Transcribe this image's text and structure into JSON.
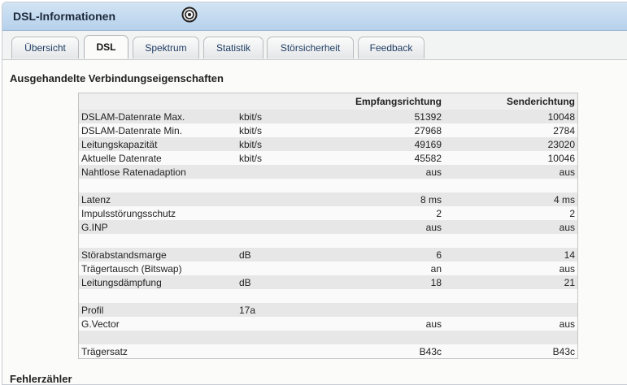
{
  "window": {
    "title": "DSL-Informationen"
  },
  "tabs": [
    {
      "label": "Übersicht",
      "active": false
    },
    {
      "label": "DSL",
      "active": true
    },
    {
      "label": "Spektrum",
      "active": false
    },
    {
      "label": "Statistik",
      "active": false
    },
    {
      "label": "Störsicherheit",
      "active": false
    },
    {
      "label": "Feedback",
      "active": false
    }
  ],
  "section": {
    "heading": "Ausgehandelte Verbindungseigenschaften",
    "next_heading_partial": "Fehlerzähler"
  },
  "table": {
    "headers": [
      "",
      "",
      "Empfangsrichtung",
      "Senderichtung"
    ],
    "rows": [
      [
        "DSLAM-Datenrate Max.",
        "kbit/s",
        "51392",
        "10048"
      ],
      [
        "DSLAM-Datenrate Min.",
        "kbit/s",
        "27968",
        "2784"
      ],
      [
        "Leitungskapazität",
        "kbit/s",
        "49169",
        "23020"
      ],
      [
        "Aktuelle Datenrate",
        "kbit/s",
        "45582",
        "10046"
      ],
      [
        "Nahtlose Ratenadaption",
        "",
        "aus",
        "aus"
      ],
      [
        "",
        "",
        "",
        ""
      ],
      [
        "Latenz",
        "",
        "8 ms",
        "4 ms"
      ],
      [
        "Impulsstörungsschutz",
        "",
        "2",
        "2"
      ],
      [
        "G.INP",
        "",
        "aus",
        "aus"
      ],
      [
        "",
        "",
        "",
        ""
      ],
      [
        "Störabstandsmarge",
        "dB",
        "6",
        "14"
      ],
      [
        "Trägertausch (Bitswap)",
        "",
        "an",
        "aus"
      ],
      [
        "Leitungsdämpfung",
        "dB",
        "18",
        "21"
      ],
      [
        "",
        "",
        "",
        ""
      ],
      [
        "Profil",
        "17a",
        "",
        ""
      ],
      [
        "G.Vector",
        "",
        "aus",
        "aus"
      ],
      [
        "",
        "",
        "",
        ""
      ],
      [
        "Trägersatz",
        "",
        "B43c",
        "B43c"
      ]
    ]
  },
  "icons": {
    "busy": "busy-spinner-icon"
  }
}
